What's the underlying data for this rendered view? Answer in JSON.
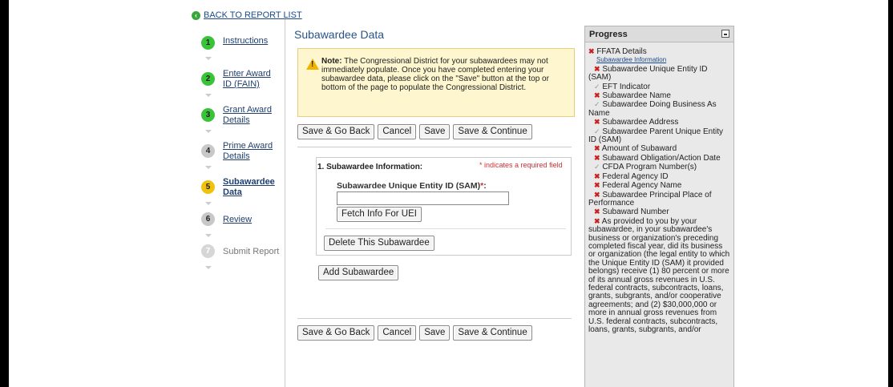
{
  "back_link": "BACK TO REPORT LIST",
  "steps": [
    {
      "num": "1",
      "label": "Instructions"
    },
    {
      "num": "2",
      "label": "Enter Award ID (FAIN)"
    },
    {
      "num": "3",
      "label": "Grant Award Details"
    },
    {
      "num": "4",
      "label": "Prime Award Details"
    },
    {
      "num": "5",
      "label": "Subawardee Data"
    },
    {
      "num": "6",
      "label": "Review"
    },
    {
      "num": "7",
      "label": "Submit Report"
    }
  ],
  "page_title": "Subawardee Data",
  "note": {
    "bold": "Note:",
    "text": " The Congressional District for your subawardees may not immediately populate. Once you have completed entering your subawardee data, please click on the \"Save\" button at the top or bottom of the page to populate the Congressional District."
  },
  "buttons": {
    "save_go_back": "Save & Go Back",
    "cancel": "Cancel",
    "save": "Save",
    "save_continue": "Save & Continue",
    "fetch": "Fetch Info For UEI",
    "delete": "Delete This Subawardee",
    "add": "Add Subawardee"
  },
  "section": {
    "title": "1. Subawardee Information:",
    "required_mark": "*",
    "required_text": " indicates a required field",
    "uei_label": "Subawardee Unique Entity ID (SAM)",
    "uei_value": ""
  },
  "progress": {
    "title": "Progress",
    "heading": "FFATA Details",
    "sublink": "Subawardee Information",
    "items": [
      {
        "status": "x",
        "text": "Subawardee Unique Entity ID (SAM)"
      },
      {
        "status": "check",
        "text": "EFT Indicator"
      },
      {
        "status": "x",
        "text": "Subawardee Name"
      },
      {
        "status": "check",
        "text": "Subawardee Doing Business As Name"
      },
      {
        "status": "x",
        "text": "Subawardee Address"
      },
      {
        "status": "check",
        "text": "Subawardee Parent Unique Entity ID (SAM)"
      },
      {
        "status": "x",
        "text": "Amount of Subaward"
      },
      {
        "status": "x",
        "text": "Subaward Obligation/Action Date"
      },
      {
        "status": "check",
        "text": "CFDA Program Number(s)"
      },
      {
        "status": "x",
        "text": "Federal Agency ID"
      },
      {
        "status": "x",
        "text": "Federal Agency Name"
      },
      {
        "status": "x",
        "text": "Subawardee Principal Place of Performance"
      },
      {
        "status": "x",
        "text": "Subaward Number"
      },
      {
        "status": "x",
        "text": "As provided to you by your subawardee, in your subawardee's business or organization's preceding completed fiscal year, did its business or organization (the legal entity to which the Unique Entity ID (SAM) it provided belongs) receive (1) 80 percent or more of its annual gross revenues in U.S. federal contracts, subcontracts, loans, grants, subgrants, and/or cooperative agreements; and (2) $30,000,000 or more in annual gross revenues from U.S. federal contracts, subcontracts, loans, grants, subgrants, and/or"
      }
    ]
  }
}
